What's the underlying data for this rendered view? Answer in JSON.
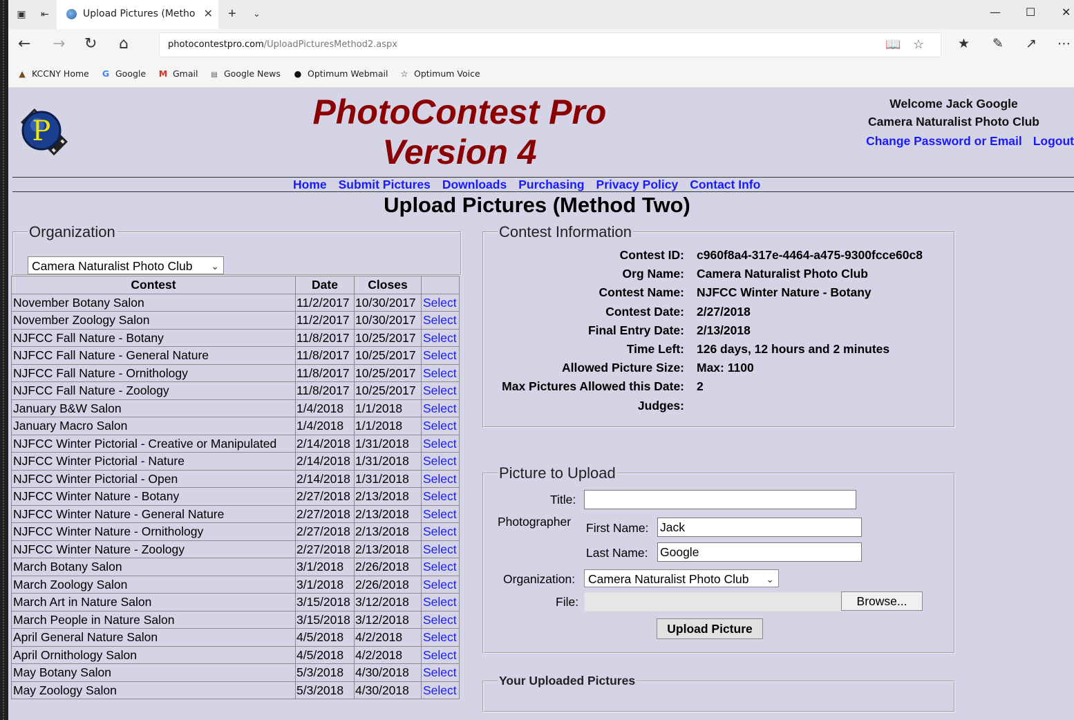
{
  "browser": {
    "tab_title": "Upload Pictures (Metho",
    "url_host": "photocontestpro.com",
    "url_path": "/UploadPicturesMethod2.aspx",
    "favorites": [
      {
        "label": "KCCNY Home",
        "icon": "kccny-icon"
      },
      {
        "label": "Google",
        "icon": "google-icon"
      },
      {
        "label": "Gmail",
        "icon": "gmail-icon"
      },
      {
        "label": "Google News",
        "icon": "news-icon"
      },
      {
        "label": "Optimum Webmail",
        "icon": "optimum-icon"
      },
      {
        "label": "Optimum Voice",
        "icon": "star-outline-icon"
      }
    ]
  },
  "header": {
    "brand_line1": "PhotoContest Pro",
    "brand_line2": "Version 4",
    "welcome": "Welcome Jack Google",
    "club": "Camera Naturalist Photo Club",
    "change_password": "Change Password or Email",
    "logout": "Logout",
    "brand_color": "#8b0000",
    "link_color": "#1a1aff"
  },
  "menu": [
    "Home",
    "Submit Pictures",
    "Downloads",
    "Purchasing",
    "Privacy Policy",
    "Contact Info"
  ],
  "page_title": "Upload Pictures (Method Two)",
  "organization": {
    "legend": "Organization",
    "selected": "Camera Naturalist Photo Club"
  },
  "contests_table": {
    "headers": [
      "Contest",
      "Date",
      "Closes",
      ""
    ],
    "select_label": "Select",
    "rows": [
      [
        "November Botany Salon",
        "11/2/2017",
        "10/30/2017"
      ],
      [
        "November Zoology Salon",
        "11/2/2017",
        "10/30/2017"
      ],
      [
        "NJFCC Fall Nature - Botany",
        "11/8/2017",
        "10/25/2017"
      ],
      [
        "NJFCC Fall Nature - General Nature",
        "11/8/2017",
        "10/25/2017"
      ],
      [
        "NJFCC Fall Nature - Ornithology",
        "11/8/2017",
        "10/25/2017"
      ],
      [
        "NJFCC Fall Nature - Zoology",
        "11/8/2017",
        "10/25/2017"
      ],
      [
        "January B&W Salon",
        "1/4/2018",
        "1/1/2018"
      ],
      [
        "January Macro Salon",
        "1/4/2018",
        "1/1/2018"
      ],
      [
        "NJFCC Winter Pictorial - Creative or Manipulated",
        "2/14/2018",
        "1/31/2018"
      ],
      [
        "NJFCC Winter Pictorial - Nature",
        "2/14/2018",
        "1/31/2018"
      ],
      [
        "NJFCC Winter Pictorial - Open",
        "2/14/2018",
        "1/31/2018"
      ],
      [
        "NJFCC Winter Nature - Botany",
        "2/27/2018",
        "2/13/2018"
      ],
      [
        "NJFCC Winter Nature - General Nature",
        "2/27/2018",
        "2/13/2018"
      ],
      [
        "NJFCC Winter Nature - Ornithology",
        "2/27/2018",
        "2/13/2018"
      ],
      [
        "NJFCC Winter Nature - Zoology",
        "2/27/2018",
        "2/13/2018"
      ],
      [
        "March Botany Salon",
        "3/1/2018",
        "2/26/2018"
      ],
      [
        "March Zoology Salon",
        "3/1/2018",
        "2/26/2018"
      ],
      [
        "March Art in Nature Salon",
        "3/15/2018",
        "3/12/2018"
      ],
      [
        "March People in Nature Salon",
        "3/15/2018",
        "3/12/2018"
      ],
      [
        "April General Nature Salon",
        "4/5/2018",
        "4/2/2018"
      ],
      [
        "April Ornithology Salon",
        "4/5/2018",
        "4/2/2018"
      ],
      [
        "May Botany Salon",
        "5/3/2018",
        "4/30/2018"
      ],
      [
        "May Zoology Salon",
        "5/3/2018",
        "4/30/2018"
      ]
    ]
  },
  "contest_info": {
    "legend": "Contest Information",
    "rows": [
      {
        "label": "Contest ID:",
        "value": "c960f8a4-317e-4464-a475-9300fcce60c8"
      },
      {
        "label": "Org Name:",
        "value": "Camera Naturalist Photo Club"
      },
      {
        "label": "Contest Name:",
        "value": "NJFCC Winter Nature - Botany"
      },
      {
        "label": "Contest Date:",
        "value": "2/27/2018"
      },
      {
        "label": "Final Entry Date:",
        "value": "2/13/2018"
      },
      {
        "label": "Time Left:",
        "value": "126 days, 12 hours and 2 minutes"
      },
      {
        "label": "Allowed Picture Size:",
        "value": "Max: 1100"
      },
      {
        "label": "Max Pictures Allowed this Date:",
        "value": "2"
      },
      {
        "label": "Judges:",
        "value": ""
      }
    ]
  },
  "upload": {
    "legend": "Picture to Upload",
    "title_label": "Title:",
    "title_value": "",
    "photographer_label": "Photographer",
    "first_name_label": "First Name:",
    "first_name_value": "Jack",
    "last_name_label": "Last Name:",
    "last_name_value": "Google",
    "organization_label": "Organization:",
    "organization_value": "Camera Naturalist Photo Club",
    "file_label": "File:",
    "browse_label": "Browse...",
    "upload_button": "Upload Picture"
  },
  "uploaded": {
    "legend": "Your Uploaded Pictures"
  }
}
